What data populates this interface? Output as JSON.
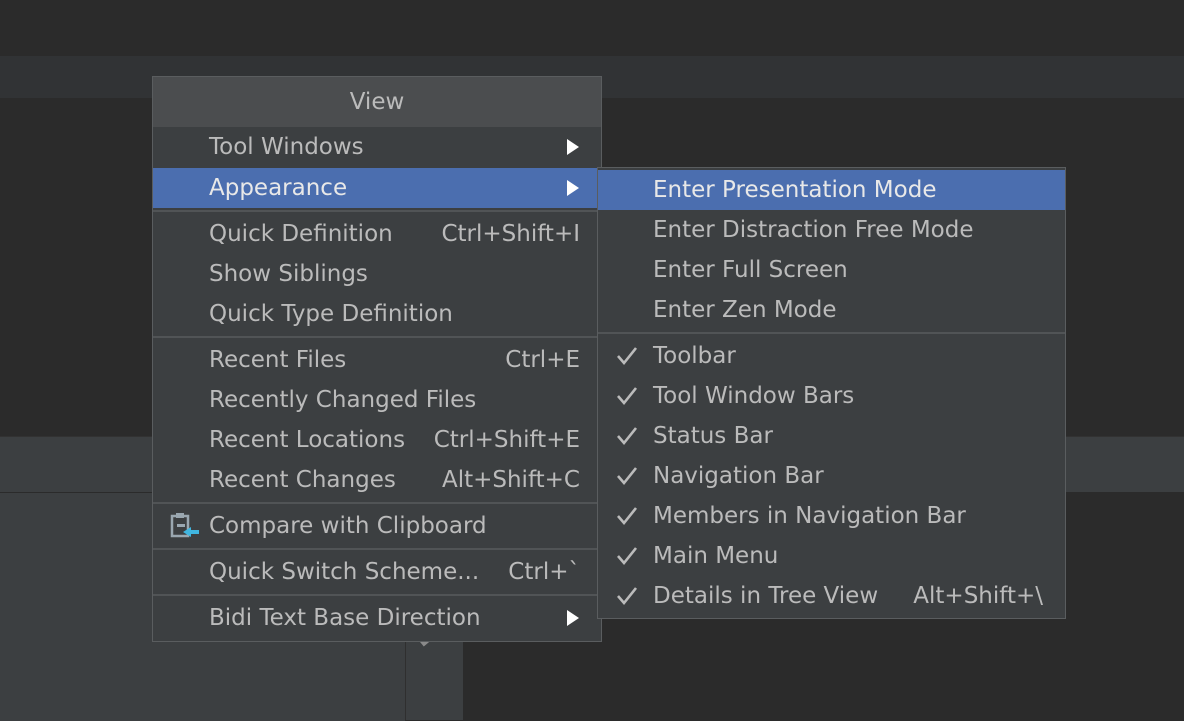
{
  "main_menu": {
    "title": "View",
    "items": [
      {
        "label": "Tool Windows",
        "submenu": true
      },
      {
        "label": "Appearance",
        "submenu": true,
        "selected": true
      },
      {
        "label": "Quick Definition",
        "shortcut": "Ctrl+Shift+I"
      },
      {
        "label": "Show Siblings"
      },
      {
        "label": "Quick Type Definition"
      },
      {
        "label": "Recent Files",
        "shortcut": "Ctrl+E"
      },
      {
        "label": "Recently Changed Files"
      },
      {
        "label": "Recent Locations",
        "shortcut": "Ctrl+Shift+E"
      },
      {
        "label": "Recent Changes",
        "shortcut": "Alt+Shift+C"
      },
      {
        "label": "Compare with Clipboard",
        "icon": "compare-clipboard-icon"
      },
      {
        "label": "Quick Switch Scheme...",
        "shortcut": "Ctrl+`"
      },
      {
        "label": "Bidi Text Base Direction",
        "submenu": true
      }
    ]
  },
  "appearance_submenu": {
    "items": [
      {
        "label": "Enter Presentation Mode",
        "selected": true
      },
      {
        "label": "Enter Distraction Free Mode"
      },
      {
        "label": "Enter Full Screen"
      },
      {
        "label": "Enter Zen Mode"
      },
      {
        "label": "Toolbar",
        "checked": true
      },
      {
        "label": "Tool Window Bars",
        "checked": true
      },
      {
        "label": "Status Bar",
        "checked": true
      },
      {
        "label": "Navigation Bar",
        "checked": true
      },
      {
        "label": "Members in Navigation Bar",
        "checked": true
      },
      {
        "label": "Main Menu",
        "checked": true
      },
      {
        "label": "Details in Tree View",
        "checked": true,
        "shortcut": "Alt+Shift+\\"
      }
    ]
  },
  "colors": {
    "menu_bg": "#3c3f41",
    "selection": "#4b6eaf",
    "text": "#bbbbbb",
    "title_bg": "#4b4d4f"
  }
}
